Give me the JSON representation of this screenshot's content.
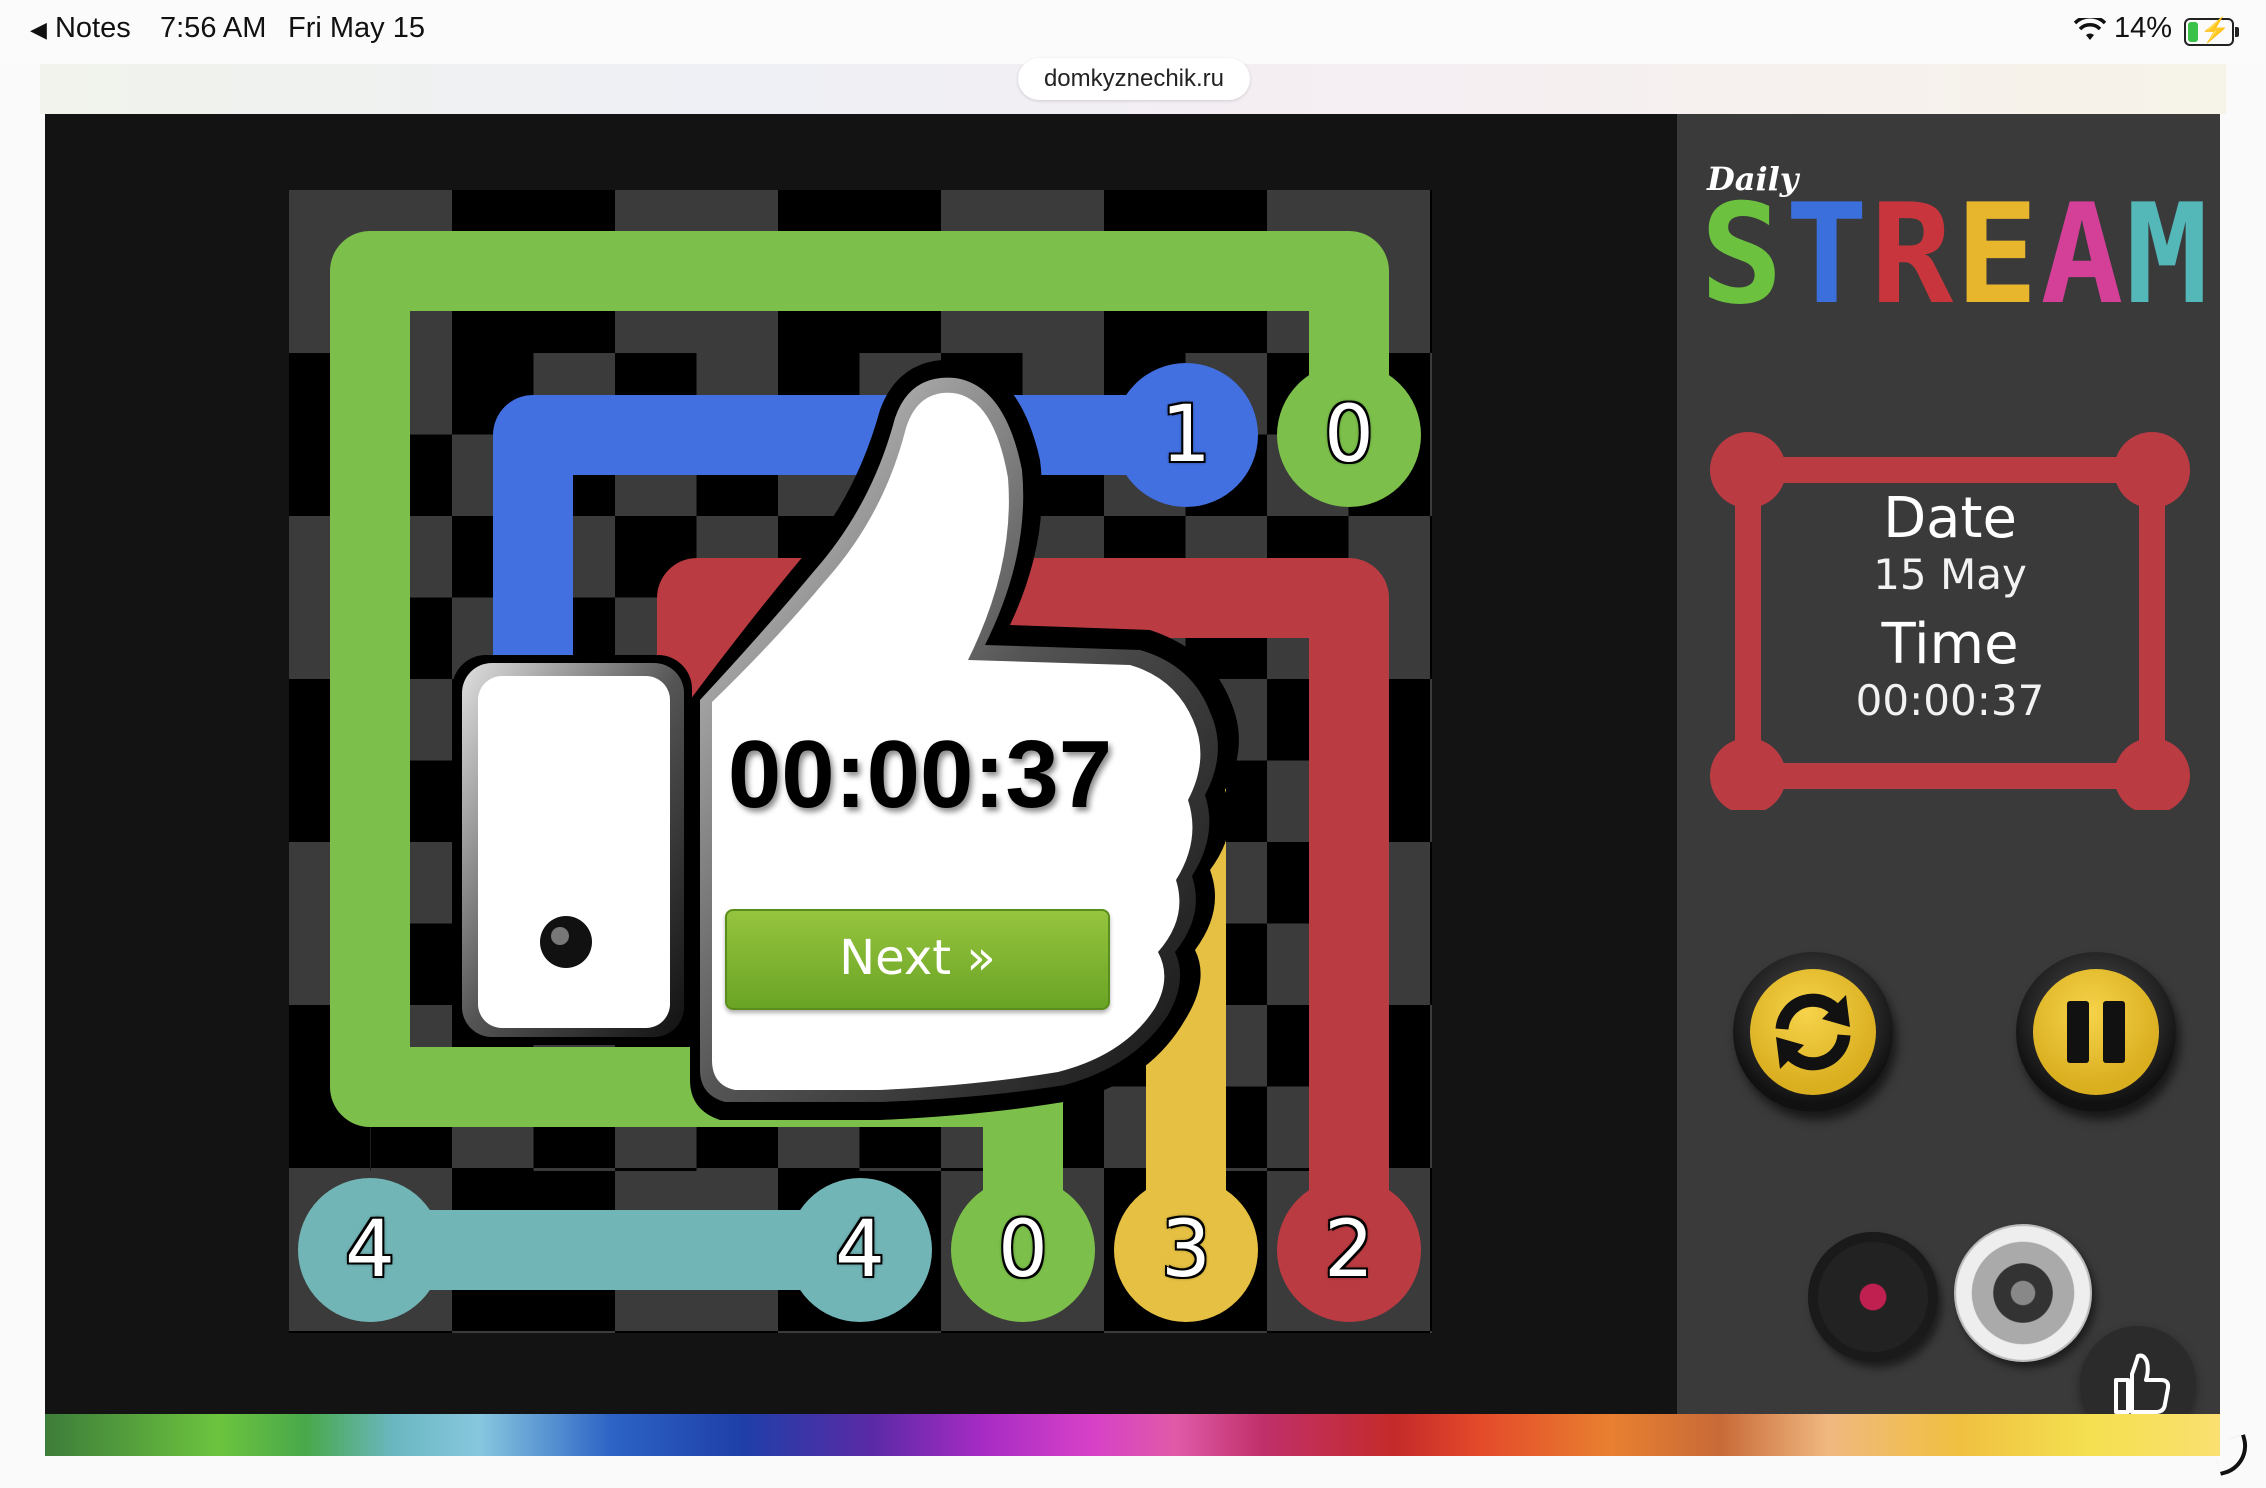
{
  "status_bar": {
    "back_app": "Notes",
    "time": "7:56 AM",
    "date": "Fri May 15",
    "battery": "14%"
  },
  "browser": {
    "url": "domkyznechik.ru"
  },
  "game": {
    "logo_prefix": "Daily",
    "logo_letters": [
      {
        "ch": "S",
        "color": "#6cc13f"
      },
      {
        "ch": "T",
        "color": "#3a6fdc"
      },
      {
        "ch": "R",
        "color": "#c8353c"
      },
      {
        "ch": "E",
        "color": "#e8b62d"
      },
      {
        "ch": "A",
        "color": "#d43f97"
      },
      {
        "ch": "M",
        "color": "#54b7b8"
      }
    ],
    "date_label": "Date",
    "date_value": "15 May",
    "time_label": "Time",
    "time_value": "00:00:37",
    "result_time": "00:00:37",
    "next_label": "Next »",
    "colors": {
      "green": "#7cc04b",
      "blue": "#4270e0",
      "red": "#bb3b42",
      "yellow": "#e5c043",
      "teal": "#72b5b7",
      "gold_button": "#e8c230"
    },
    "endpoints": [
      {
        "label": "1",
        "color": "blue"
      },
      {
        "label": "0",
        "color": "green"
      },
      {
        "label": "4",
        "color": "teal"
      },
      {
        "label": "4",
        "color": "teal"
      },
      {
        "label": "0",
        "color": "green"
      },
      {
        "label": "3",
        "color": "yellow"
      },
      {
        "label": "2",
        "color": "red"
      }
    ],
    "icons": [
      "refresh-icon",
      "pause-icon",
      "music-vinyl-icon",
      "speaker-icon",
      "thumbs-up-icon"
    ]
  }
}
